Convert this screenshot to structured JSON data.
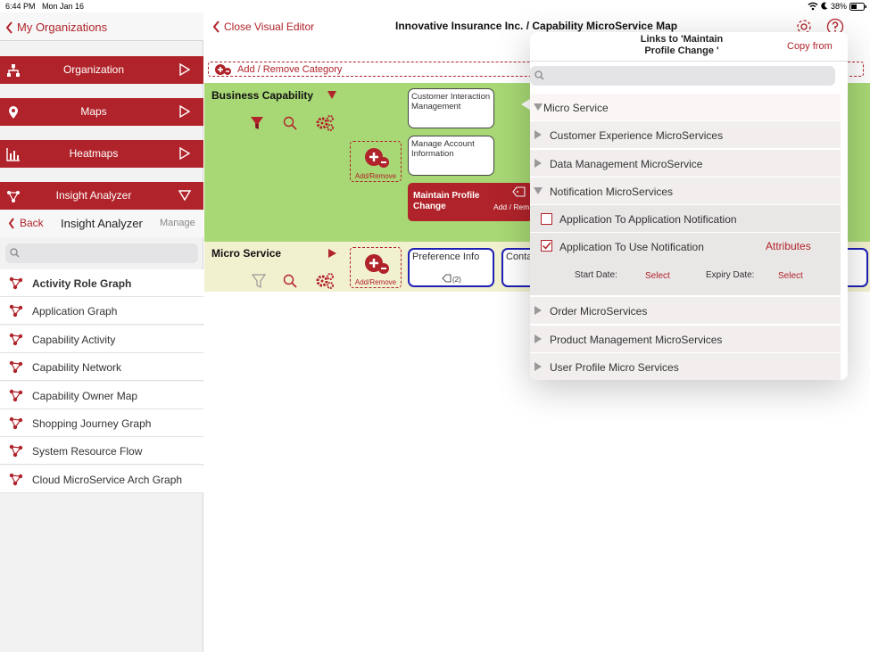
{
  "status_bar": {
    "time": "6:44 PM",
    "date": "Mon Jan 16",
    "battery": "38%"
  },
  "left_panel": {
    "back_label": "My Organizations",
    "sections": [
      {
        "label": "Organization",
        "icon": "org-chart-icon",
        "arrow": "play-right-icon"
      },
      {
        "label": "Maps",
        "icon": "map-pin-icon",
        "arrow": "play-right-icon"
      },
      {
        "label": "Heatmaps",
        "icon": "bar-chart-icon",
        "arrow": "play-right-icon"
      },
      {
        "label": "Insight Analyzer",
        "icon": "graph-nodes-icon",
        "arrow": "triangle-down-icon"
      }
    ],
    "sub_header": {
      "back_label": "Back",
      "title": "Insight Analyzer",
      "manage_label": "Manage"
    },
    "search_placeholder": "",
    "items": [
      "Activity Role Graph",
      "Application Graph",
      "Capability Activity",
      "Capability Network",
      "Capability Owner Map",
      "Shopping Journey Graph",
      "System Resource Flow",
      "Cloud MicroService Arch Graph"
    ]
  },
  "main": {
    "close_label": "Close Visual Editor",
    "title": "Innovative Insurance Inc. / Capability MicroService Map",
    "add_remove_category": "Add / Remove Category",
    "business_capability": {
      "label": "Business Capability",
      "filter_count": "1",
      "add_remove_label": "Add/Remove",
      "cards": [
        "Customer Interaction Management",
        "Manage Account Information"
      ],
      "selected_card": {
        "label": "Maintain Profile Change",
        "action_label": "Add / Rem Depende"
      }
    },
    "micro_service": {
      "label": "Micro Service",
      "add_remove_label": "Add/Remove",
      "cards": [
        {
          "label": "Preference Info",
          "count": "(2)"
        },
        {
          "label": "Conta"
        }
      ]
    }
  },
  "popover": {
    "title_line1": "Links to 'Maintain",
    "title_line2": "Profile Change '",
    "copy_from_label": "Copy from",
    "search_placeholder": "",
    "root_label": "Micro Service",
    "groups": [
      "Customer Experience MicroServices",
      "Data Management MicroService",
      "Notification MicroServices"
    ],
    "notification_items": [
      {
        "label": "Application To Application Notification",
        "checked": false
      },
      {
        "label": "Application To Use Notification",
        "checked": true,
        "attributes_label": "Attributes"
      }
    ],
    "date_row": {
      "start_label": "Start Date:",
      "start_value": "Select",
      "expiry_label": "Expiry Date:",
      "expiry_value": "Select"
    },
    "more_groups": [
      "Order MicroServices",
      "Product Management MicroServices",
      "User Profile Micro Services"
    ]
  },
  "colors": {
    "brand_red": "#b0232a",
    "capability_green": "#a8d875",
    "microservice_yellow": "#f2f1cf",
    "card_blue": "#1f1fb5"
  }
}
